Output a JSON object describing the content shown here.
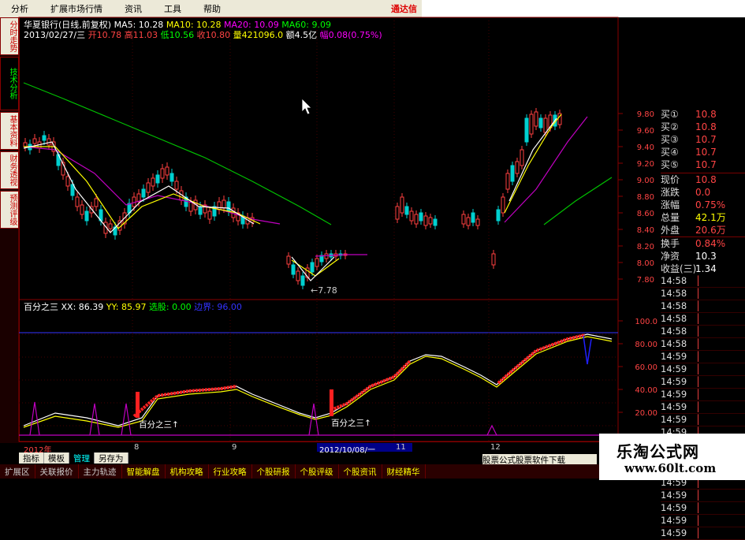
{
  "menu": [
    "分析",
    "扩展市场行情",
    "资讯",
    "工具",
    "帮助"
  ],
  "brand": "通达信",
  "side_tabs": [
    "分时走势",
    "技术分析",
    "基本资料",
    "财务透视",
    "预测评级"
  ],
  "header": {
    "title": "华夏银行(日线,前复权)",
    "ma5": "MA5: 10.28",
    "ma10": "MA10: 10.28",
    "ma20": "MA20: 10.09",
    "ma60": "MA60: 9.09",
    "date": "2013/02/27/三",
    "open": "开10.78",
    "high": "高11.03",
    "low": "低10.56",
    "close": "收10.80",
    "volume": "量421096.0",
    "amount": "额4.5亿",
    "change": "幅0.08(0.75%)"
  },
  "price_axis": [
    "9.80",
    "9.60",
    "9.40",
    "9.20",
    "9.00",
    "8.80",
    "8.60",
    "8.40",
    "8.20",
    "8.00",
    "7.80"
  ],
  "min_marker": "7.78",
  "indicator": {
    "name": "百分之三",
    "xx": "XX: 86.39",
    "yy": "YY: 85.97",
    "pick": "选股: 0.00",
    "boundary": "边界: 96.00",
    "axis": [
      "100.0",
      "80.00",
      "60.00",
      "40.00",
      "20.00"
    ],
    "signal_label_1": "百分之三↑",
    "signal_label_2": "百分之三↑"
  },
  "quote": [
    {
      "k": "买①",
      "v": "10.8"
    },
    {
      "k": "买②",
      "v": "10.8"
    },
    {
      "k": "买③",
      "v": "10.7"
    },
    {
      "k": "买④",
      "v": "10.7"
    },
    {
      "k": "买⑤",
      "v": "10.7"
    }
  ],
  "stats": [
    {
      "k": "现价",
      "v": "10.8"
    },
    {
      "k": "涨跌",
      "v": "0.0"
    },
    {
      "k": "涨幅",
      "v": "0.75%"
    },
    {
      "k": "总量",
      "v": "42.1万"
    },
    {
      "k": "外盘",
      "v": "20.6万"
    },
    {
      "k": "换手",
      "v": "0.84%"
    },
    {
      "k": "净资",
      "v": "10.3"
    },
    {
      "k": "收益(三)",
      "v": "1.34"
    }
  ],
  "ticks": [
    "14:58",
    "14:58",
    "14:58",
    "14:58",
    "14:58",
    "14:58",
    "14:59",
    "14:59",
    "14:59",
    "14:59",
    "14:59",
    "14:59",
    "14:59",
    "14:59",
    "14:59",
    "14:59",
    "14:59",
    "14:59",
    "14:59",
    "14:59",
    "14:59"
  ],
  "xaxis": {
    "y2012": "2012年",
    "m8": "8",
    "m9": "9",
    "selected": "2012/10/08/一",
    "m11": "11",
    "m12": "12"
  },
  "tabs1": [
    "指标",
    "模板",
    "管理",
    "另存为"
  ],
  "marquee": "股票公式股票软件下载",
  "tabs2": [
    "扩展区",
    "关联报价",
    "主力轨迹",
    "智能解盘",
    "机构攻略",
    "行业攻略",
    "个股研报",
    "个股评级",
    "个股资讯",
    "财经精华"
  ],
  "watermark": {
    "name": "乐淘公式网",
    "url": "www.60lt.com"
  },
  "colors": {
    "up": "#ff4040",
    "down": "#00d0d0",
    "ma5": "#ffffff",
    "ma10": "#ffff00",
    "ma20": "#ff00ff",
    "ma60": "#00ff00",
    "xx": "#ffffff",
    "yy": "#ffff00"
  }
}
